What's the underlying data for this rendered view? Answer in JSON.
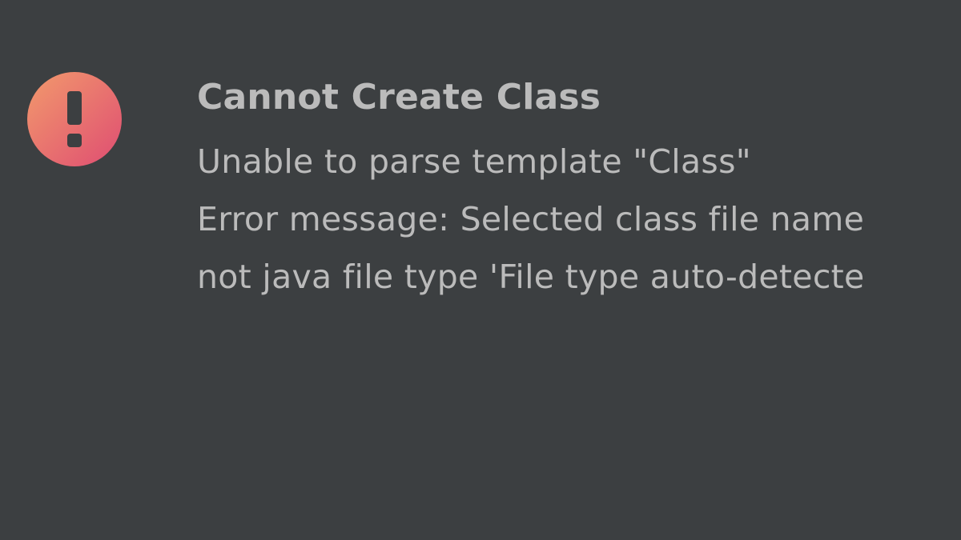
{
  "dialog": {
    "icon": "error-exclamation-icon",
    "icon_gradient": [
      "#f08a6a",
      "#e0526f"
    ],
    "icon_mark_color": "#3c3f41",
    "title": "Cannot Create Class",
    "message_lines": [
      "Unable to parse template \"Class\"",
      "Error message: Selected class file name",
      "not java file type 'File type auto-detecte"
    ]
  },
  "colors": {
    "background": "#3c3f41",
    "text": "#bbbbbb"
  }
}
